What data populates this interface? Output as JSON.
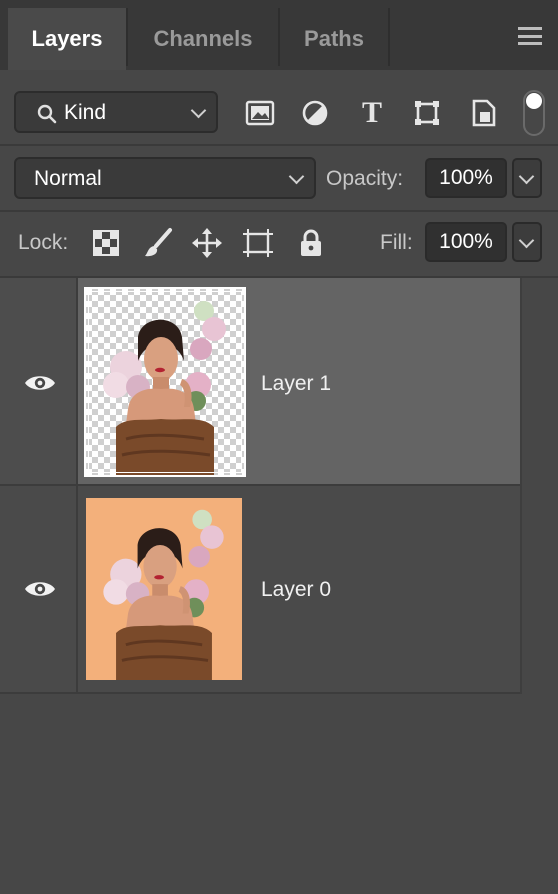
{
  "tabs": [
    {
      "label": "Layers",
      "active": true
    },
    {
      "label": "Channels",
      "active": false
    },
    {
      "label": "Paths",
      "active": false
    }
  ],
  "filter": {
    "label": "Kind",
    "icons": [
      "image-filter-icon",
      "adjustment-filter-icon",
      "type-filter-icon",
      "shape-filter-icon",
      "smart-object-filter-icon"
    ]
  },
  "blend": {
    "mode": "Normal",
    "opacity_label": "Opacity:",
    "opacity_value": "100%"
  },
  "lock": {
    "label": "Lock:",
    "fill_label": "Fill:",
    "fill_value": "100%"
  },
  "layers": [
    {
      "name": "Layer 1",
      "selected": true,
      "visible": true
    },
    {
      "name": "Layer 0",
      "selected": false,
      "visible": true
    }
  ],
  "colors": {
    "panel": "#474747",
    "selected_row": "#646464",
    "portrait_bg": "#f3b07b",
    "dress": "#7a4a2a"
  }
}
